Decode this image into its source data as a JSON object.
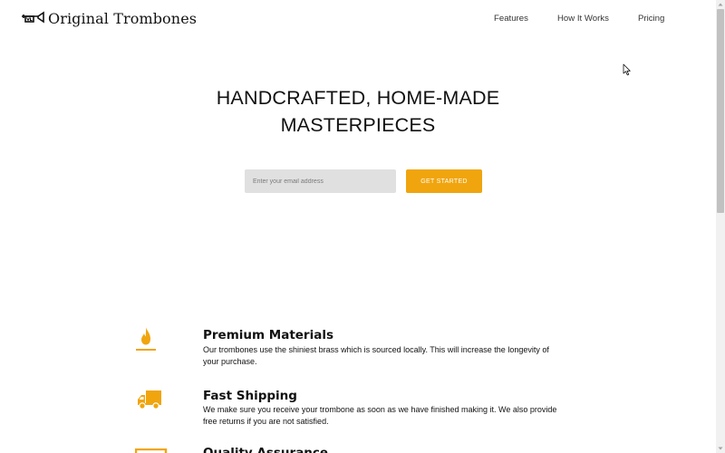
{
  "header": {
    "logo_text": "Original Trombones",
    "logo_icon": "trombone-icon",
    "nav": [
      {
        "label": "Features"
      },
      {
        "label": "How It Works"
      },
      {
        "label": "Pricing"
      }
    ]
  },
  "hero": {
    "title_line1": "HANDCRAFTED, HOME-MADE",
    "title_line2": "MASTERPIECES",
    "email_placeholder": "Enter your email address",
    "cta_label": "GET STARTED"
  },
  "features": [
    {
      "icon": "fire-icon",
      "title": "Premium Materials",
      "description": "Our trombones use the shiniest brass which is sourced locally. This will increase the longevity of your purchase."
    },
    {
      "icon": "truck-icon",
      "title": "Fast Shipping",
      "description": "We make sure you receive your trombone as soon as we have finished making it. We also provide free returns if you are not satisfied."
    },
    {
      "icon": "certificate-icon",
      "title": "Quality Assurance",
      "description": ""
    }
  ],
  "colors": {
    "accent": "#f0a50e",
    "input_bg": "#e0e0e0",
    "text": "#111111"
  }
}
